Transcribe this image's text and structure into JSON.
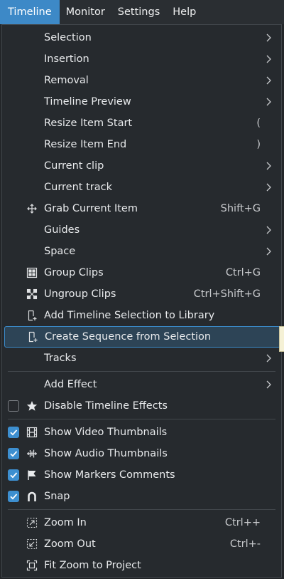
{
  "menubar": [
    "Timeline",
    "Monitor",
    "Settings",
    "Help"
  ],
  "menu": {
    "selection": "Selection",
    "insertion": "Insertion",
    "removal": "Removal",
    "timeline_preview": "Timeline Preview",
    "resize_start": {
      "label": "Resize Item Start",
      "shortcut": "("
    },
    "resize_end": {
      "label": "Resize Item End",
      "shortcut": ")"
    },
    "current_clip": "Current clip",
    "current_track": "Current track",
    "grab_item": {
      "label": "Grab Current Item",
      "shortcut": "Shift+G"
    },
    "guides": "Guides",
    "space": "Space",
    "group_clips": {
      "label": "Group Clips",
      "shortcut": "Ctrl+G"
    },
    "ungroup_clips": {
      "label": "Ungroup Clips",
      "shortcut": "Ctrl+Shift+G"
    },
    "add_selection_library": "Add Timeline Selection to Library",
    "create_sequence": "Create Sequence from Selection",
    "tracks": "Tracks",
    "add_effect": "Add Effect",
    "disable_effects": {
      "label": "Disable Timeline Effects",
      "checked": false
    },
    "video_thumbnails": {
      "label": "Show Video Thumbnails",
      "checked": true
    },
    "audio_thumbnails": {
      "label": "Show Audio Thumbnails",
      "checked": true
    },
    "markers_comments": {
      "label": "Show Markers Comments",
      "checked": true
    },
    "snap": {
      "label": "Snap",
      "checked": true
    },
    "zoom_in": {
      "label": "Zoom In",
      "shortcut": "Ctrl++"
    },
    "zoom_out": {
      "label": "Zoom Out",
      "shortcut": "Ctrl+-"
    },
    "fit_zoom": "Fit Zoom to Project"
  },
  "colors": {
    "accent": "#3d89c7",
    "menu_bg": "#262a2e",
    "highlight_bg": "#2d4456",
    "text": "#e8eaec"
  },
  "icons": {
    "grab_item": "move-icon",
    "group_clips": "group-icon",
    "ungroup_clips": "ungroup-icon",
    "add_selection_library": "library-add-icon",
    "create_sequence": "library-add-icon",
    "disable_effects": "star-icon",
    "video_thumbnails": "film-icon",
    "audio_thumbnails": "audio-wave-icon",
    "markers_comments": "flag-icon",
    "snap": "magnet-icon",
    "zoom_in": "zoom-in-icon",
    "zoom_out": "zoom-out-icon",
    "fit_zoom": "zoom-fit-icon"
  }
}
